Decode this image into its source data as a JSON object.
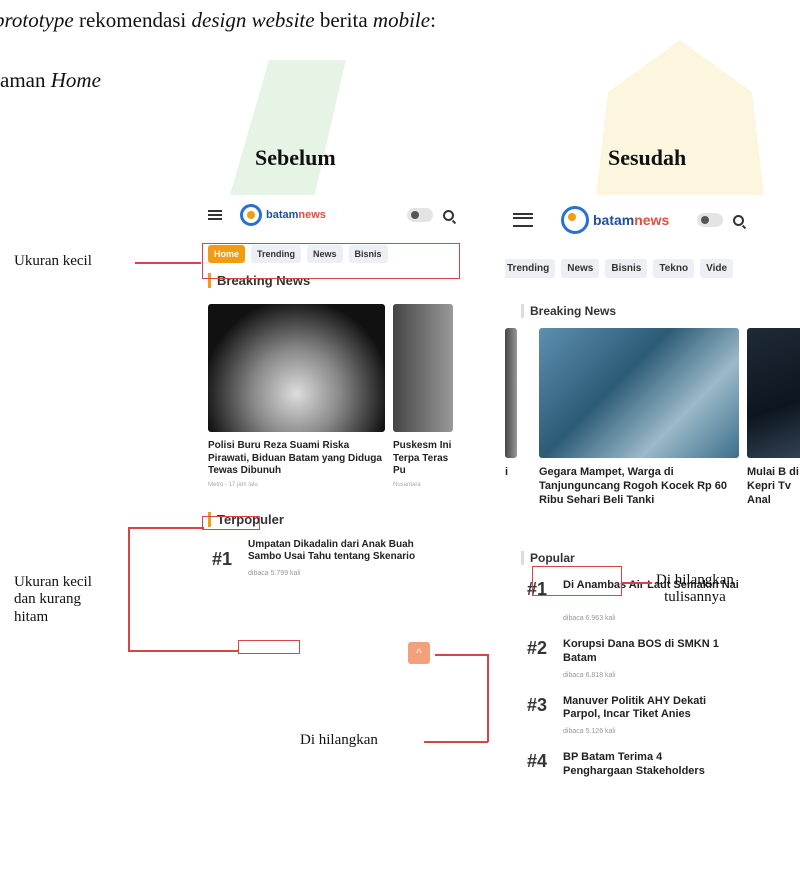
{
  "doc": {
    "line1": {
      "italic1": "prototype",
      "plain1": " rekomendasi ",
      "italic2": "design website",
      "plain2": " berita ",
      "italic3": "mobile",
      "plain3": ":"
    },
    "line2": {
      "plain": "aman ",
      "italic": "Home"
    },
    "heading_before": "Sebelum",
    "heading_after": "Sesudah"
  },
  "annotations": {
    "small_size": "Ukuran kecil",
    "small_not_black": "Ukuran kecil\ndan kurang\nhitam",
    "removed": "Di hilangkan",
    "removed_text": "Di hilangkan\ntulisannya"
  },
  "before": {
    "logo_a": "batam",
    "logo_b": "news",
    "tabs": [
      "Home",
      "Trending",
      "News",
      "Bisnis"
    ],
    "active_tab": "Home",
    "breaking_title": "Breaking News",
    "cards": [
      {
        "title": "Polisi Buru Reza Suami Riska Pirawati, Biduan Batam yang Diduga Tewas Dibunuh",
        "meta": "Metro - 17 jam lalu",
        "image": "bw"
      },
      {
        "title": "Puskesm Ini Terpa Teras Pu",
        "meta": "Nusantara",
        "image": "grey"
      }
    ],
    "popular_title": "Terpopuler",
    "popular": [
      {
        "rank": "#1",
        "title": "Umpatan Dikadalin dari Anak Buah Sambo Usai Tahu tentang Skenario",
        "meta": "dibaca 5.799 kali"
      }
    ],
    "scroll_top_icon": "chevron-up-icon"
  },
  "after": {
    "logo_a": "batam",
    "logo_b": "news",
    "tabs": [
      "Trending",
      "News",
      "Bisnis",
      "Tekno",
      "Vide"
    ],
    "breaking_title": "Breaking News",
    "cards": [
      {
        "title": "Gegara Mampet, Warga di Tanjunguncang Rogoh Kocek Rp 60 Ribu Sehari Beli Tanki",
        "image": "blue"
      },
      {
        "title": "Mulai B di Kepri Tv Anal",
        "image": "dark"
      }
    ],
    "left_fragment": "i",
    "popular_title": "Popular",
    "popular": [
      {
        "rank": "#1",
        "title": "Di Anambas Air Laut Semakin Nai",
        "meta": "dibaca 6.963 kali"
      },
      {
        "rank": "#2",
        "title": "Korupsi Dana BOS di SMKN 1 Batam",
        "meta": "dibaca 6.818 kali"
      },
      {
        "rank": "#3",
        "title": "Manuver Politik AHY Dekati Parpol, Incar Tiket Anies",
        "meta": "dibaca 5.126 kali"
      },
      {
        "rank": "#4",
        "title": "BP Batam Terima 4 Penghargaan Stakeholders",
        "meta": ""
      }
    ]
  }
}
